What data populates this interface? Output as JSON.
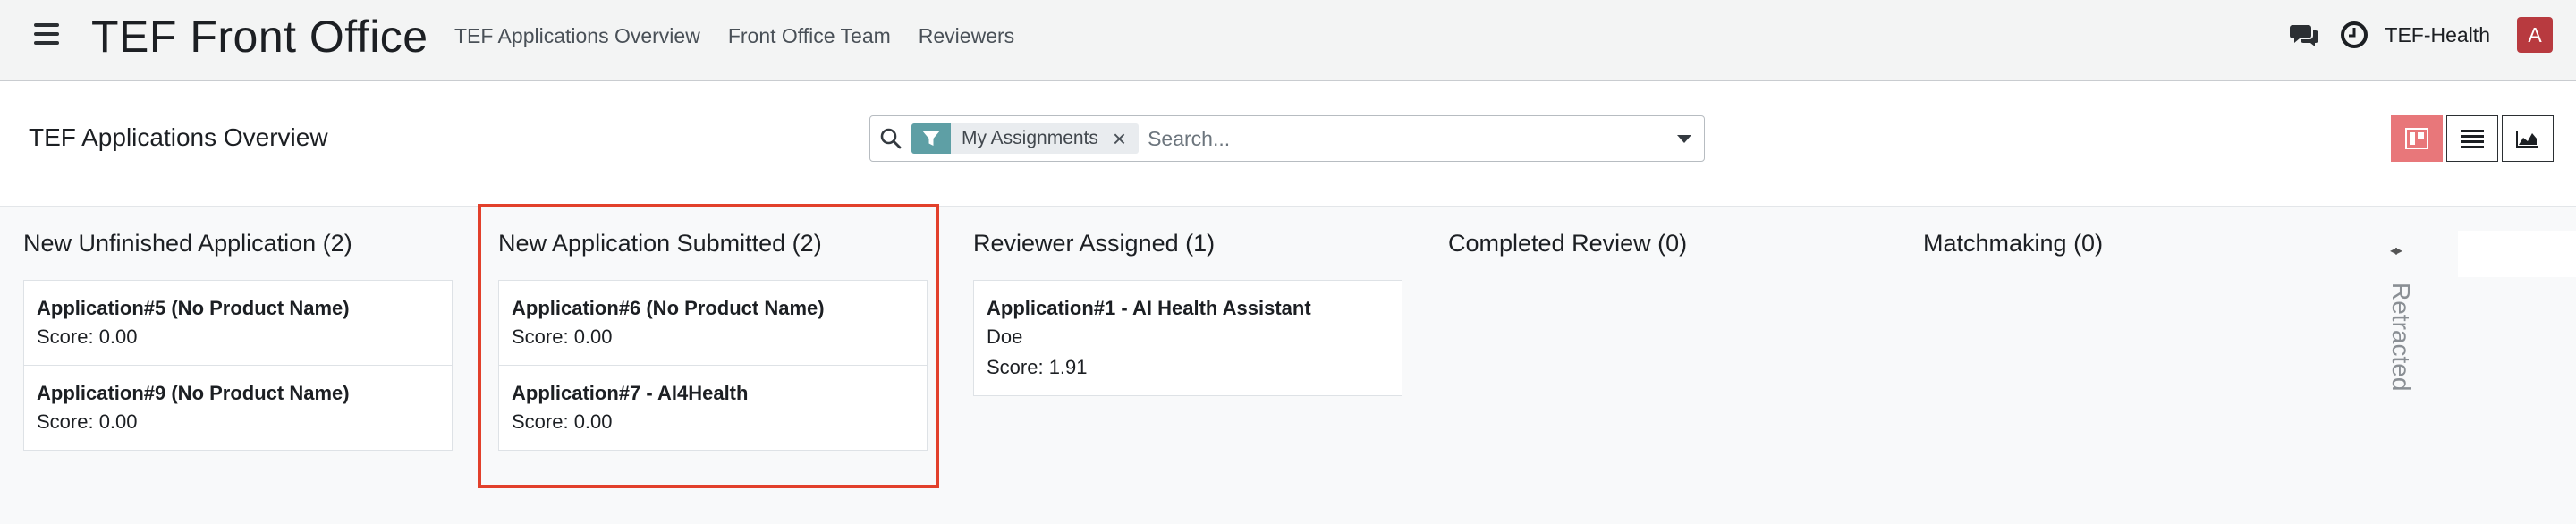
{
  "navbar": {
    "app_title": "TEF Front Office",
    "links": [
      "TEF Applications Overview",
      "Front Office Team",
      "Reviewers"
    ],
    "company": "TEF-Health",
    "avatar_letter": "A"
  },
  "control_panel": {
    "page_title": "TEF Applications Overview",
    "search": {
      "facet_label": "My Assignments",
      "facet_remove": "×",
      "placeholder": "Search..."
    }
  },
  "kanban": {
    "columns": [
      {
        "title": "New Unfinished Application (2)",
        "cards": [
          {
            "title": "Application#5 (No Product Name)",
            "lines": [
              "Score: 0.00"
            ]
          },
          {
            "title": "Application#9 (No Product Name)",
            "lines": [
              "Score: 0.00"
            ]
          }
        ]
      },
      {
        "title": "New Application Submitted (2)",
        "cards": [
          {
            "title": "Application#6 (No Product Name)",
            "lines": [
              "Score: 0.00"
            ]
          },
          {
            "title": "Application#7 - AI4Health",
            "lines": [
              "Score: 0.00"
            ]
          }
        ]
      },
      {
        "title": "Reviewer Assigned (1)",
        "cards": [
          {
            "title": "Application#1 - AI Health Assistant",
            "lines": [
              "Doe",
              "Score: 1.91"
            ]
          }
        ]
      },
      {
        "title": "Completed Review (0)",
        "cards": []
      },
      {
        "title": "Matchmaking (0)",
        "cards": []
      }
    ],
    "folded": {
      "arrows": "◂▸",
      "label": "Retracted"
    }
  },
  "colors": {
    "accent": "#e8777a",
    "facet": "#5e9fa5",
    "avatar": "#b83a3f",
    "highlight": "#e2402b"
  }
}
